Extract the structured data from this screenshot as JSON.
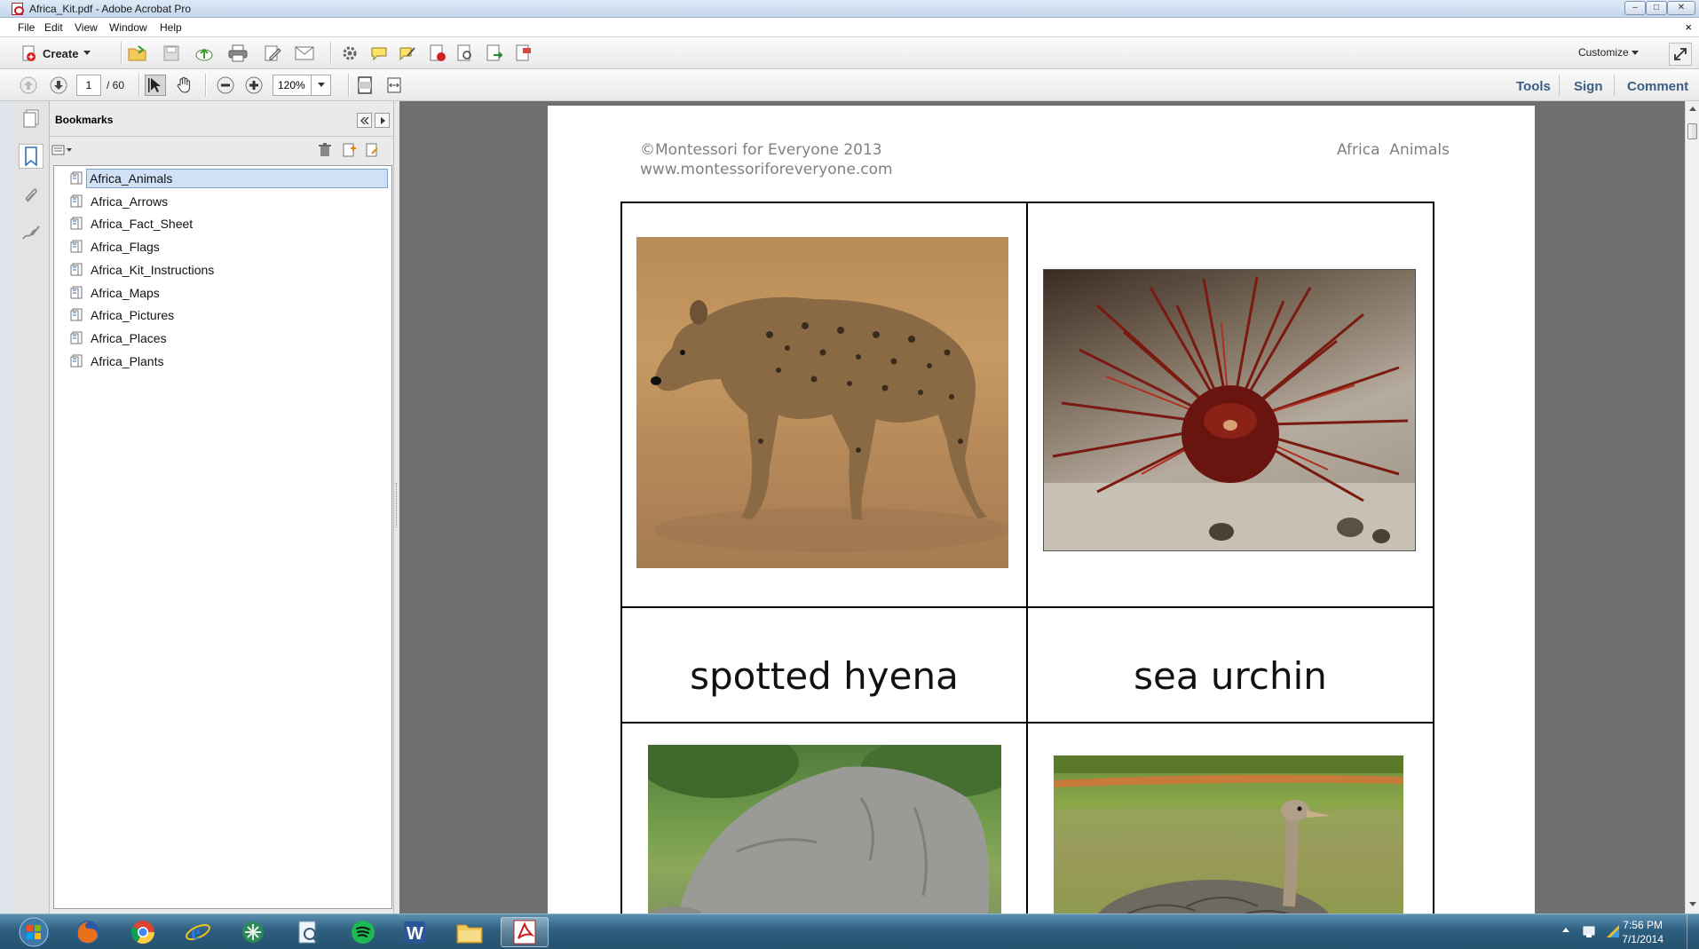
{
  "window": {
    "title": "Africa_Kit.pdf - Adobe Acrobat Pro",
    "buttons": {
      "minimize": "–",
      "maximize": "□",
      "close": "✕"
    }
  },
  "menu": {
    "items": [
      "File",
      "Edit",
      "View",
      "Window",
      "Help"
    ],
    "close_doc": "×"
  },
  "toolbar": {
    "create_label": "Create",
    "customize_label": "Customize",
    "current_page": "1",
    "page_total": "/ 60",
    "zoom": "120%",
    "tabs": [
      "Tools",
      "Sign",
      "Comment"
    ]
  },
  "bookmarks": {
    "title": "Bookmarks",
    "items": [
      {
        "label": "Africa_Animals",
        "selected": true
      },
      {
        "label": "Africa_Arrows"
      },
      {
        "label": "Africa_Fact_Sheet"
      },
      {
        "label": "Africa_Flags"
      },
      {
        "label": "Africa_Kit_Instructions"
      },
      {
        "label": "Africa_Maps"
      },
      {
        "label": "Africa_Pictures"
      },
      {
        "label": "Africa_Places"
      },
      {
        "label": "Africa_Plants"
      }
    ]
  },
  "document": {
    "header_left_1": "©Montessori for Everyone 2013",
    "header_left_2": "www.montessoriforeveryone.com",
    "header_right": "Africa  Animals",
    "cards": [
      {
        "label": "spotted hyena",
        "image": "hyena-photo"
      },
      {
        "label": "sea urchin",
        "image": "sea-urchin-photo"
      },
      {
        "label": "",
        "image": "rhinoceros-photo"
      },
      {
        "label": "",
        "image": "ostrich-photo"
      }
    ]
  },
  "taskbar": {
    "time": "7:56 PM",
    "date": "7/1/2014",
    "apps": [
      "start-orb-icon",
      "firefox-icon",
      "chrome-icon",
      "internet-explorer-icon",
      "network-icon",
      "search-icon",
      "spotify-icon",
      "word-icon",
      "file-explorer-icon",
      "acrobat-icon"
    ]
  }
}
